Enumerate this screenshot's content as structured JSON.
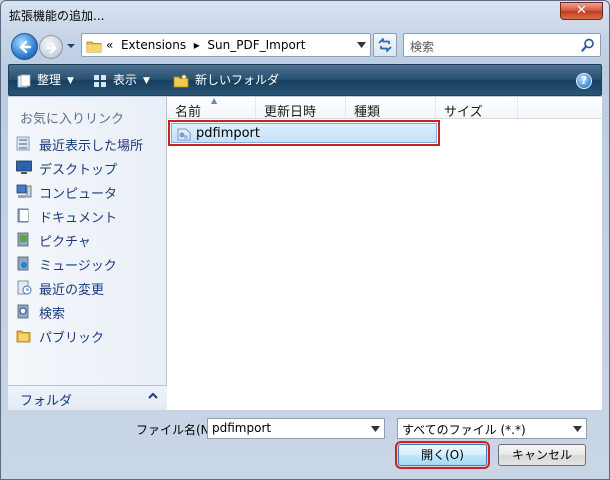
{
  "window": {
    "title": "拡張機能の追加...",
    "close_label": "✕"
  },
  "address": {
    "path": "«  Extensions  ▸  Sun_PDF_Import",
    "path_parts": [
      "Extensions",
      "Sun_PDF_Import"
    ]
  },
  "search": {
    "placeholder": "検索"
  },
  "toolbar": {
    "organize": "整理",
    "views": "表示",
    "new_folder": "新しいフォルダ",
    "help": "?"
  },
  "sidebar": {
    "heading": "お気に入りリンク",
    "items": [
      {
        "label": "最近表示した場所",
        "icon": "recent-places-icon"
      },
      {
        "label": "デスクトップ",
        "icon": "desktop-icon"
      },
      {
        "label": "コンピュータ",
        "icon": "computer-icon"
      },
      {
        "label": "ドキュメント",
        "icon": "documents-icon"
      },
      {
        "label": "ピクチャ",
        "icon": "pictures-icon"
      },
      {
        "label": "ミュージック",
        "icon": "music-icon"
      },
      {
        "label": "最近の変更",
        "icon": "recent-changes-icon"
      },
      {
        "label": "検索",
        "icon": "search-folder-icon"
      },
      {
        "label": "パブリック",
        "icon": "public-folder-icon"
      }
    ],
    "folders_label": "フォルダ"
  },
  "filelist": {
    "columns": [
      "名前",
      "更新日時",
      "種類",
      "サイズ"
    ],
    "files": [
      {
        "name": "pdfimport",
        "icon": "extension-file-icon",
        "selected": true
      }
    ]
  },
  "footer": {
    "filename_label": "ファイル名(N):",
    "filename_value": "pdfimport",
    "filetype_value": "すべてのファイル (*.*)",
    "open_label": "開く(O)",
    "cancel_label": "キャンセル"
  },
  "colors": {
    "toolbar": "#27506f",
    "selection": "#c4e1fb",
    "highlight": "#cc2222"
  }
}
